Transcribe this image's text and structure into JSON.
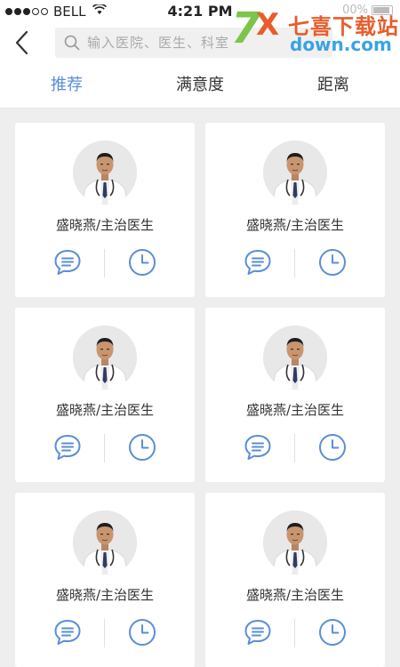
{
  "status_bar": {
    "carrier": "BELL",
    "time": "4:21 PM",
    "battery_text": "00%"
  },
  "header": {
    "search_placeholder": "输入医院、医生、科室"
  },
  "watermark": {
    "seven": "7",
    "x": "X",
    "cn": "七喜下载站",
    "domain": "down.com"
  },
  "tabs": [
    {
      "label": "推荐",
      "active": true
    },
    {
      "label": "满意度",
      "active": false
    },
    {
      "label": "距离",
      "active": false
    }
  ],
  "doctors": [
    {
      "name": "盛晓燕/主治医生"
    },
    {
      "name": "盛晓燕/主治医生"
    },
    {
      "name": "盛晓燕/主治医生"
    },
    {
      "name": "盛晓燕/主治医生"
    },
    {
      "name": "盛晓燕/主治医生"
    },
    {
      "name": "盛晓燕/主治医生"
    }
  ],
  "colors": {
    "accent": "#5a8ed6",
    "icon": "#5a8ed6",
    "background": "#eeeeee"
  }
}
